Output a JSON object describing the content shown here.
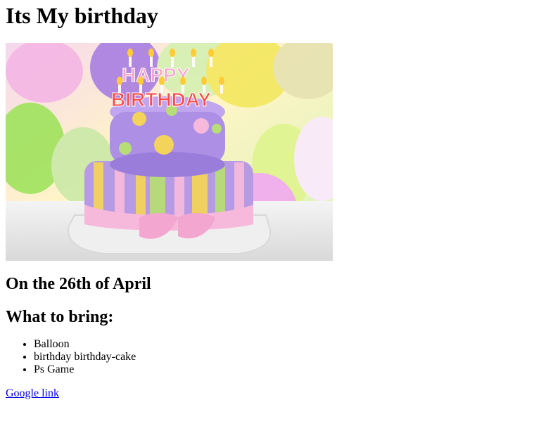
{
  "page": {
    "title": "Its My birthday",
    "image_alt": "Birthday cake with Happy Birthday candles",
    "candle_text": "HAPPY BIRTHDAY",
    "date_heading": "On the 26th of April",
    "bring_heading": "What to bring:",
    "bring_items": [
      "Balloon",
      "birthday birthday-cake",
      "Ps Game"
    ],
    "link_text": "Google link"
  },
  "colors": {
    "text": "#000000",
    "link": "#0000ee",
    "background": "#ffffff",
    "cake_purple": "#a58bd6",
    "cake_pink": "#f4b8d8",
    "cake_yellow": "#f4d35a",
    "cake_green": "#a8d36b"
  }
}
